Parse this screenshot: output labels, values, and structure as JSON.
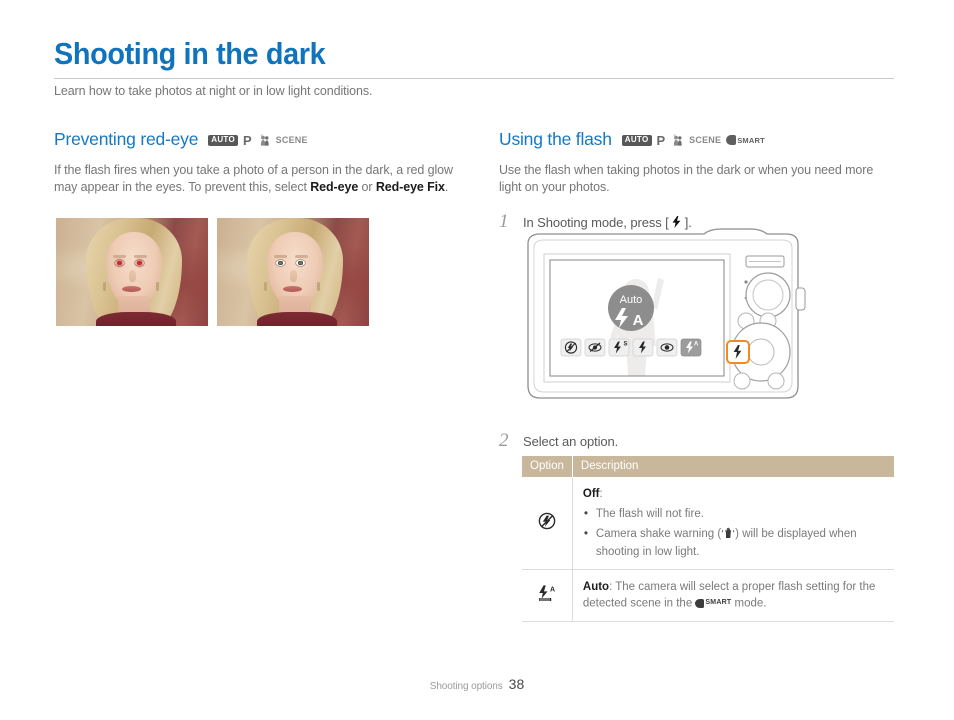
{
  "document": {
    "title": "Shooting in the dark",
    "subtitle": "Learn how to take photos at night or in low light conditions.",
    "accent_color": "#1073be",
    "table_header_color": "#c8b79b",
    "highlight_color": "#f08a24"
  },
  "left_column": {
    "section_title": "Preventing red-eye",
    "modes": [
      {
        "name": "auto-mode-badge",
        "label": "AUTO"
      },
      {
        "name": "program-mode-badge",
        "label": "P"
      },
      {
        "name": "dual-is-mode-badge",
        "label": ""
      },
      {
        "name": "scene-mode-badge",
        "label": "SCENE"
      }
    ],
    "paragraph": {
      "part1": "If the flash fires when you take a photo of a person in the dark, a red glow may appear in the eyes. To prevent this, select ",
      "bold1": "Red-eye",
      "part2": " or ",
      "bold2": "Red-eye Fix",
      "part3": "."
    },
    "photos": [
      {
        "name": "photo-with-red-eye",
        "caption": ""
      },
      {
        "name": "photo-red-eye-corrected",
        "caption": ""
      }
    ]
  },
  "right_column": {
    "section_title": "Using the flash",
    "modes": [
      {
        "name": "auto-mode-badge",
        "label": "AUTO"
      },
      {
        "name": "program-mode-badge",
        "label": "P"
      },
      {
        "name": "dual-is-mode-badge",
        "label": ""
      },
      {
        "name": "scene-mode-badge",
        "label": "SCENE"
      },
      {
        "name": "smart-mode-badge",
        "label": "SMART"
      }
    ],
    "paragraph": "Use the flash when taking photos in the dark or when you need more light on your photos.",
    "steps": [
      {
        "number": "1",
        "text_before": "In Shooting mode, press [",
        "key": "⚡",
        "text_after": "]."
      },
      {
        "number": "2",
        "text": "Select an option."
      }
    ],
    "camera": {
      "lcd_badge_label": "Auto",
      "lcd_badge_glyph": "A",
      "flash_options_count": 6,
      "selected_option_index": 5,
      "highlighted_button": "flash-button"
    },
    "table": {
      "headers": [
        "Option",
        "Description"
      ],
      "rows": [
        {
          "icon_name": "flash-off-icon",
          "label": "Off",
          "label_suffix": ":",
          "bullets": [
            "The flash will not fire.",
            "Camera shake warning (🖐) will be displayed when shooting in low light."
          ],
          "bullet1": "The flash will not fire.",
          "bullet2_before": "Camera shake warning (",
          "bullet2_icon": "shake-warning-icon",
          "bullet2_after": ") will be displayed when shooting in low light."
        },
        {
          "icon_name": "flash-auto-icon",
          "label": "Auto",
          "label_suffix": ": ",
          "text_before": "The camera will select a proper flash setting for the detected scene in the ",
          "smart_label": "SMART",
          "text_after": " mode."
        }
      ]
    }
  },
  "footer": {
    "label": "Shooting options",
    "page_number": "38"
  }
}
